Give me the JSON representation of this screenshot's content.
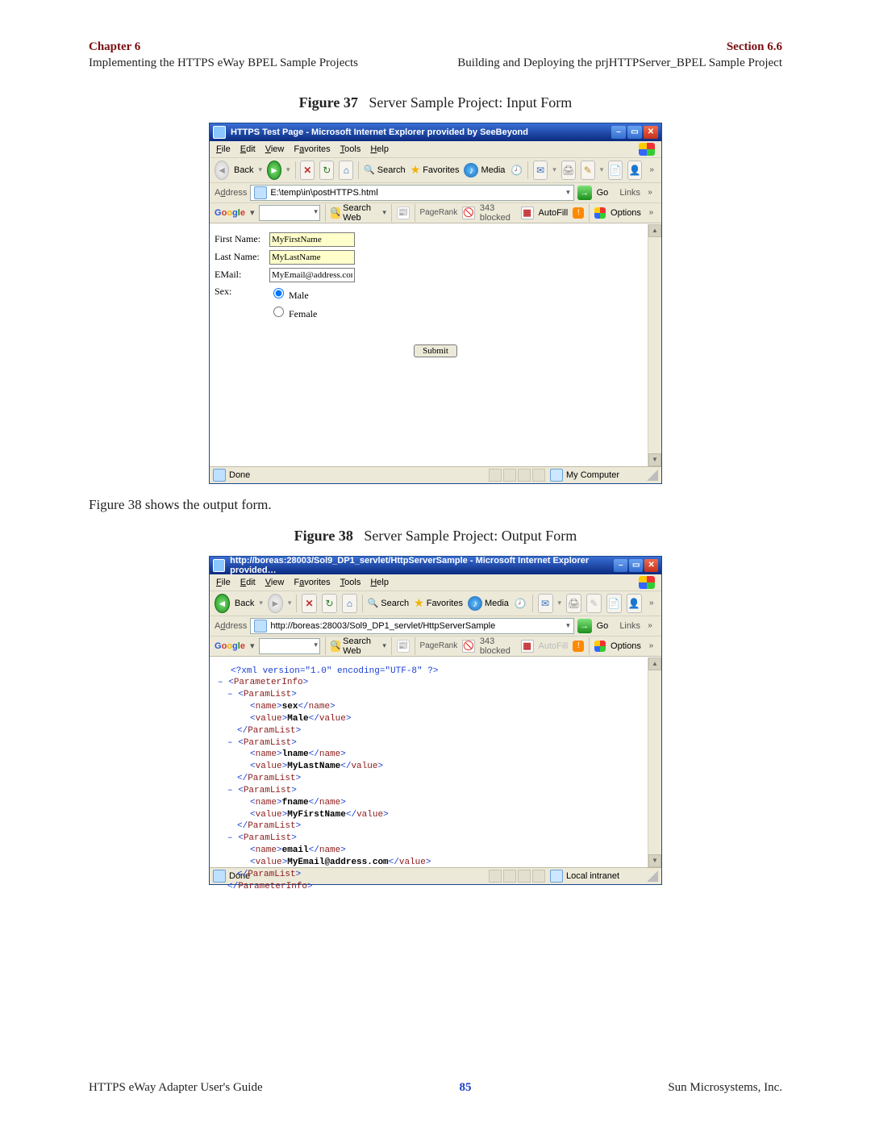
{
  "header": {
    "chapter": "Chapter 6",
    "left_sub": "Implementing the HTTPS eWay BPEL Sample Projects",
    "section": "Section 6.6",
    "right_sub": "Building and Deploying the prjHTTPServer_BPEL Sample Project"
  },
  "figure37": {
    "caption_bold": "Figure 37",
    "caption_rest": "Server Sample Project: Input Form"
  },
  "body_para": "Figure 38 shows the output form.",
  "figure38": {
    "caption_bold": "Figure 38",
    "caption_rest": "Server Sample Project: Output Form"
  },
  "ie_menu": [
    "File",
    "Edit",
    "View",
    "Favorites",
    "Tools",
    "Help"
  ],
  "ie_toolbar": {
    "back": "Back",
    "search": "Search",
    "favorites": "Favorites",
    "media": "Media"
  },
  "ie_addr": {
    "label": "Address",
    "go": "Go",
    "links": "Links"
  },
  "google_bar": {
    "search_web": "Search Web",
    "pagerank": "PageRank",
    "blocked": "343 blocked",
    "autofill": "AutoFill",
    "options": "Options"
  },
  "ie1": {
    "title": "HTTPS Test Page - Microsoft Internet Explorer provided by SeeBeyond",
    "address": "E:\\temp\\in\\postHTTPS.html",
    "form": {
      "first_name_label": "First Name:",
      "first_name_value": "MyFirstName",
      "last_name_label": "Last Name:",
      "last_name_value": "MyLastName",
      "email_label": "EMail:",
      "email_value": "MyEmail@address.com",
      "sex_label": "Sex:",
      "male": "Male",
      "female": "Female",
      "submit": "Submit"
    },
    "status_left": "Done",
    "status_zone": "My Computer",
    "content_height": 300
  },
  "ie2": {
    "title": "http://boreas:28003/Sol9_DP1_servlet/HttpServerSample - Microsoft Internet Explorer provided…",
    "address": "http://boreas:28003/Sol9_DP1_servlet/HttpServerSample",
    "xml": {
      "decl": "<?xml version=\"1.0\" encoding=\"UTF-8\" ?>",
      "params": [
        {
          "name": "sex",
          "value": "Male"
        },
        {
          "name": "lname",
          "value": "MyLastName"
        },
        {
          "name": "fname",
          "value": "MyFirstName"
        },
        {
          "name": "email",
          "value": "MyEmail@address.com"
        }
      ]
    },
    "status_left": "Done",
    "status_zone": "Local intranet",
    "content_height": 260
  },
  "footer": {
    "left": "HTTPS eWay Adapter User's Guide",
    "page": "85",
    "right": "Sun Microsystems, Inc."
  }
}
